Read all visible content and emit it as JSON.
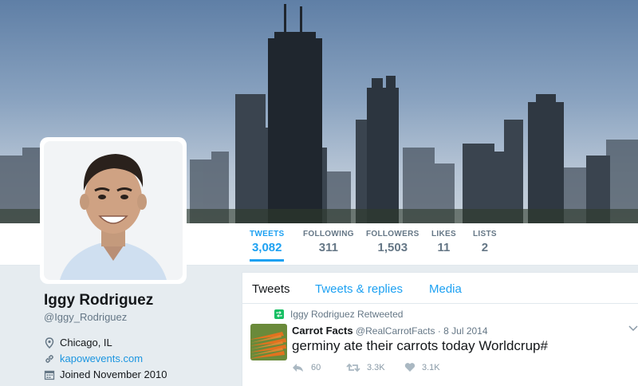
{
  "profile": {
    "name": "Iggy Rodriguez",
    "handle": "@Iggy_Rodriguez",
    "location": "Chicago, IL",
    "website": "kapowevents.com",
    "joined": "Joined November 2010"
  },
  "stats": [
    {
      "label": "TWEETS",
      "value": "3,082",
      "active": true
    },
    {
      "label": "FOLLOWING",
      "value": "311"
    },
    {
      "label": "FOLLOWERS",
      "value": "1,503"
    },
    {
      "label": "LIKES",
      "value": "11"
    },
    {
      "label": "LISTS",
      "value": "2"
    }
  ],
  "tabs": [
    {
      "label": "Tweets",
      "active": true
    },
    {
      "label": "Tweets & replies"
    },
    {
      "label": "Media"
    }
  ],
  "tweet": {
    "retweet_context": "Iggy Rodriguez Retweeted",
    "author_name": "Carrot Facts",
    "author_handle": "@RealCarrotFacts",
    "separator": "·",
    "date": "8 Jul 2014",
    "text": "germiny ate their carrots today Worldcrup#",
    "replies": "60",
    "retweets": "3.3K",
    "likes": "3.1K"
  },
  "colors": {
    "accent": "#1da1f2",
    "link": "#1b95e0",
    "retweet_green": "#17bf63",
    "muted": "#657786",
    "page_bg": "#e6ecf0"
  }
}
